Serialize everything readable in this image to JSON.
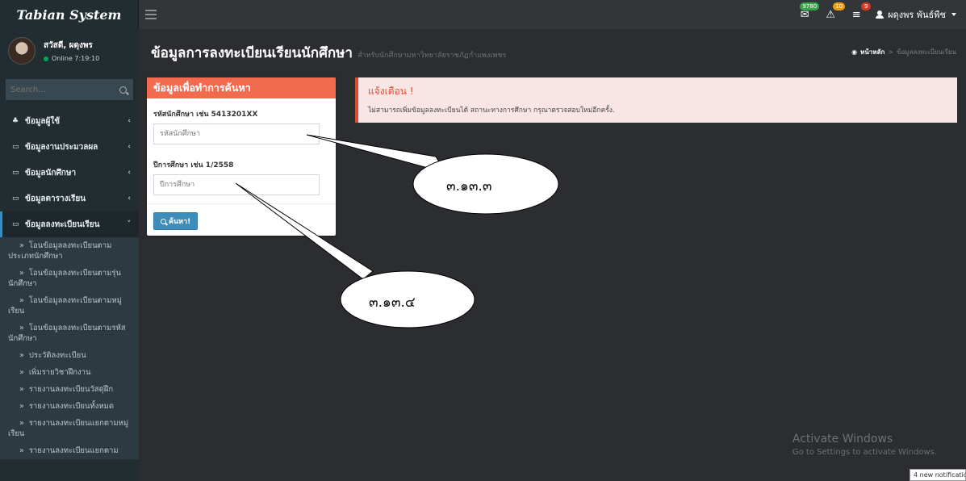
{
  "app": {
    "title": "Tabian System"
  },
  "topbar": {
    "mail_badge": "9780",
    "alert_badge": "10",
    "tasks_badge": "9",
    "user_name": "ผดุงพร พันธ์พืช"
  },
  "sidebar": {
    "greeting": "สวัสดี, ผดุงพร",
    "status": "Online 7:19:10",
    "search_placeholder": "Search...",
    "menu": [
      {
        "label": "ข้อมูลผู้ใช้"
      },
      {
        "label": "ข้อมูลงานประมวลผล"
      },
      {
        "label": "ข้อมูลนักศึกษา"
      },
      {
        "label": "ข้อมูลตารางเรียน"
      },
      {
        "label": "ข้อมูลลงทะเบียนเรียน"
      }
    ],
    "submenu": [
      "โอนข้อมูลลงทะเบียนตามประเภทนักศึกษา",
      "โอนข้อมูลลงทะเบียนตามรุ่นนักศึกษา",
      "โอนข้อมูลลงทะเบียนตามหมู่เรียน",
      "โอนข้อมูลลงทะเบียนตามรหัสนักศึกษา",
      "ประวัติลงทะเบียน",
      "เพิ่มรายวิชาฝึกงาน",
      "รายงานลงทะเบียนวัสดุฝึก",
      "รายงานลงทะเบียนทั้งหมด",
      "รายงานลงทะเบียนแยกตามหมู่เรียน",
      "รายงานลงทะเบียนแยกตาม"
    ]
  },
  "header": {
    "title": "ข้อมูลการลงทะเบียนเรียนนักศึกษา",
    "subtitle": "สำหรับนักศึกษามหาวิทยาลัยราชภัฏกำแพงเพชร",
    "breadcrumb_home": "หน้าหลัก",
    "breadcrumb_sep": ">",
    "breadcrumb_current": "ข้อมูลลงทะเบียนเรียน"
  },
  "search_panel": {
    "title": "ข้อมูลเพื่อทำการค้นหา",
    "student_id_label": "รหัสนักศึกษา เช่น 5413201XX",
    "student_id_placeholder": "รหัสนักศึกษา",
    "year_label": "ปีการศึกษา เช่น 1/2558",
    "year_placeholder": "ปีการศึกษา",
    "button_label": "ค้นหา!"
  },
  "alert": {
    "title": "แจ้งเตือน !",
    "message": "ไม่สามารถเพิ่มข้อมูลลงทะเบียนได้ สถานะทางการศึกษา กรุณาตรวจสอบใหม่อีกครั้ง."
  },
  "callouts": {
    "first": "๓.๑๓.๓",
    "second": "๓.๑๓.๔"
  },
  "watermark": {
    "line1": "Activate Windows",
    "line2": "Go to Settings to activate Windows."
  },
  "notification": "4 new notificatio",
  "colors": {
    "panel_header": "#f26b4f",
    "primary_button": "#3c8dbc",
    "alert_border": "#dd4b39",
    "sidebar": "#222d32"
  }
}
